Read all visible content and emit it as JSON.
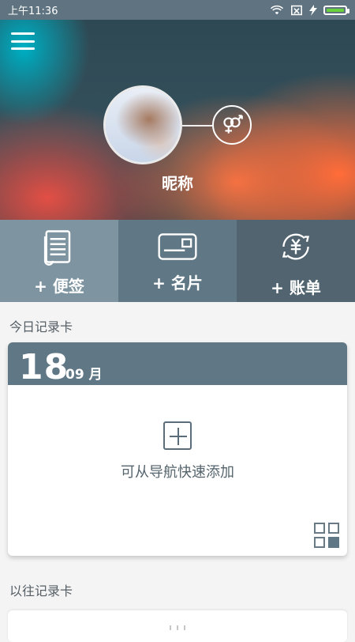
{
  "status": {
    "time": "上午11:36"
  },
  "header": {
    "nickname": "昵称"
  },
  "actions": [
    {
      "label": "+ 便签",
      "icon": "notes-icon"
    },
    {
      "label": "+ 名片",
      "icon": "business-card-icon"
    },
    {
      "label": "+ 账单",
      "icon": "bill-refresh-icon"
    }
  ],
  "today": {
    "section_title": "今日记录卡",
    "day": "18",
    "month": "09 月",
    "hint": "可从导航快速添加"
  },
  "past": {
    "section_title": "以往记录卡"
  },
  "colors": {
    "primary": "#607886",
    "accent_orange": "#ff6e3c",
    "battery_green": "#69d13b"
  }
}
